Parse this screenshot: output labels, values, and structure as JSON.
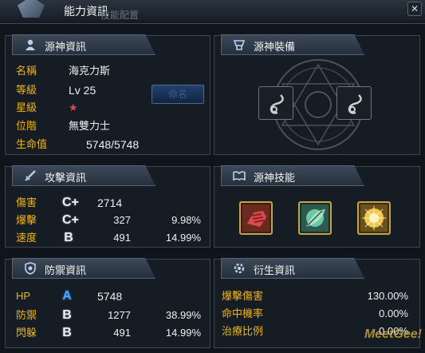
{
  "window": {
    "title": "能力資訊",
    "ghost_tab": "技能配置",
    "close_label": "✕"
  },
  "basic": {
    "header": "源神資訊",
    "rename_label": "命名",
    "rows": [
      {
        "label": "名稱",
        "value": "海克力斯"
      },
      {
        "label": "等級",
        "value": "Lv 25"
      },
      {
        "label": "星級",
        "value": "★"
      },
      {
        "label": "位階",
        "value": "無雙力士"
      },
      {
        "label": "生命值",
        "value": "5748/5748"
      }
    ]
  },
  "equipment": {
    "header": "源神裝備",
    "slots": [
      "equip-slot-left",
      "equip-slot-right"
    ]
  },
  "attack": {
    "header": "攻擊資訊",
    "rows": [
      {
        "label": "傷害",
        "grade": "C+",
        "value": "2714",
        "percent": ""
      },
      {
        "label": "爆擊",
        "grade": "C+",
        "value": "327",
        "percent": "9.98%"
      },
      {
        "label": "速度",
        "grade": "B",
        "value": "491",
        "percent": "14.99%"
      }
    ]
  },
  "skills": {
    "header": "源神技能",
    "items": [
      "fist-skill-icon",
      "leaf-skill-icon",
      "burst-skill-icon"
    ]
  },
  "defense": {
    "header": "防禦資訊",
    "rows": [
      {
        "label": "HP",
        "grade": "A",
        "value": "5748",
        "percent": ""
      },
      {
        "label": "防禦",
        "grade": "B",
        "value": "1277",
        "percent": "38.99%"
      },
      {
        "label": "閃躲",
        "grade": "B",
        "value": "491",
        "percent": "14.99%"
      }
    ]
  },
  "derived": {
    "header": "衍生資訊",
    "rows": [
      {
        "label": "爆擊傷害",
        "value": "130.00%"
      },
      {
        "label": "命中機率",
        "value": "0.00%"
      },
      {
        "label": "治療比例",
        "value": "0.00%"
      }
    ]
  },
  "watermark": "MeetGee!",
  "colors": {
    "label": "#f0b41c",
    "value": "#efefef",
    "grade_a": "#4aa8ff",
    "star": "#e24a4a"
  }
}
